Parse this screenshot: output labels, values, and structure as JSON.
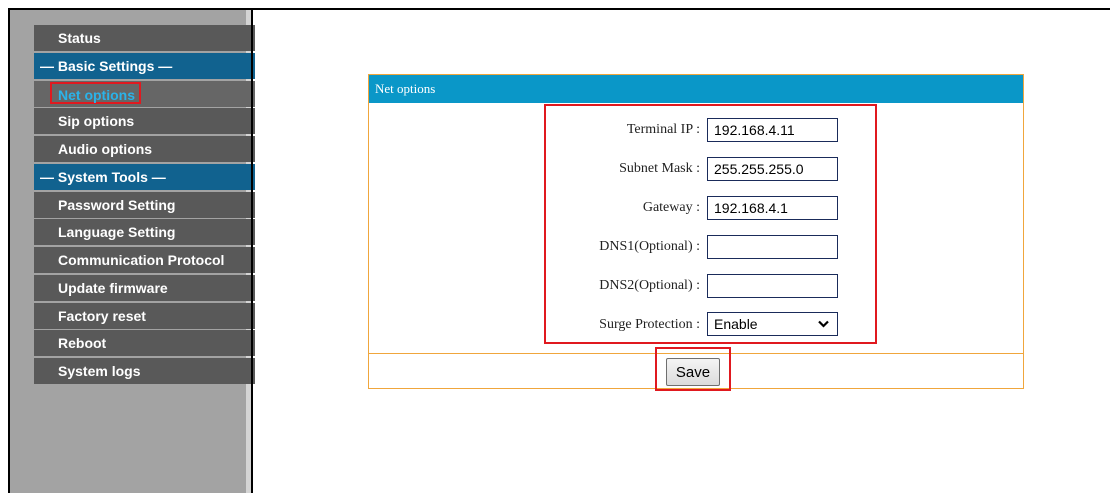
{
  "sidebar": {
    "items": [
      {
        "label": "Status"
      },
      {
        "label": "— Basic Settings —"
      },
      {
        "label": "Net options"
      },
      {
        "label": "Sip options"
      },
      {
        "label": "Audio options"
      },
      {
        "label": "— System Tools —"
      },
      {
        "label": "Password Setting"
      },
      {
        "label": "Language Setting"
      },
      {
        "label": "Communication Protocol"
      },
      {
        "label": "Update firmware"
      },
      {
        "label": "Factory reset"
      },
      {
        "label": "Reboot"
      },
      {
        "label": "System logs"
      }
    ]
  },
  "panel": {
    "title": "Net options",
    "fields": {
      "terminal_ip": {
        "label": "Terminal IP :",
        "value": "192.168.4.11"
      },
      "subnet_mask": {
        "label": "Subnet Mask :",
        "value": "255.255.255.0"
      },
      "gateway": {
        "label": "Gateway :",
        "value": "192.168.4.1"
      },
      "dns1": {
        "label": "DNS1(Optional) :",
        "value": ""
      },
      "dns2": {
        "label": "DNS2(Optional) :",
        "value": ""
      },
      "surge": {
        "label": "Surge Protection :",
        "value": "Enable"
      }
    },
    "save_label": "Save"
  },
  "colors": {
    "sidebar_item": "#595959",
    "sidebar_section": "#11628f",
    "active_text": "#2ab3e9",
    "panel_header": "#0a97c8",
    "panel_border": "#f0a63c",
    "highlight": "#e0191f"
  }
}
